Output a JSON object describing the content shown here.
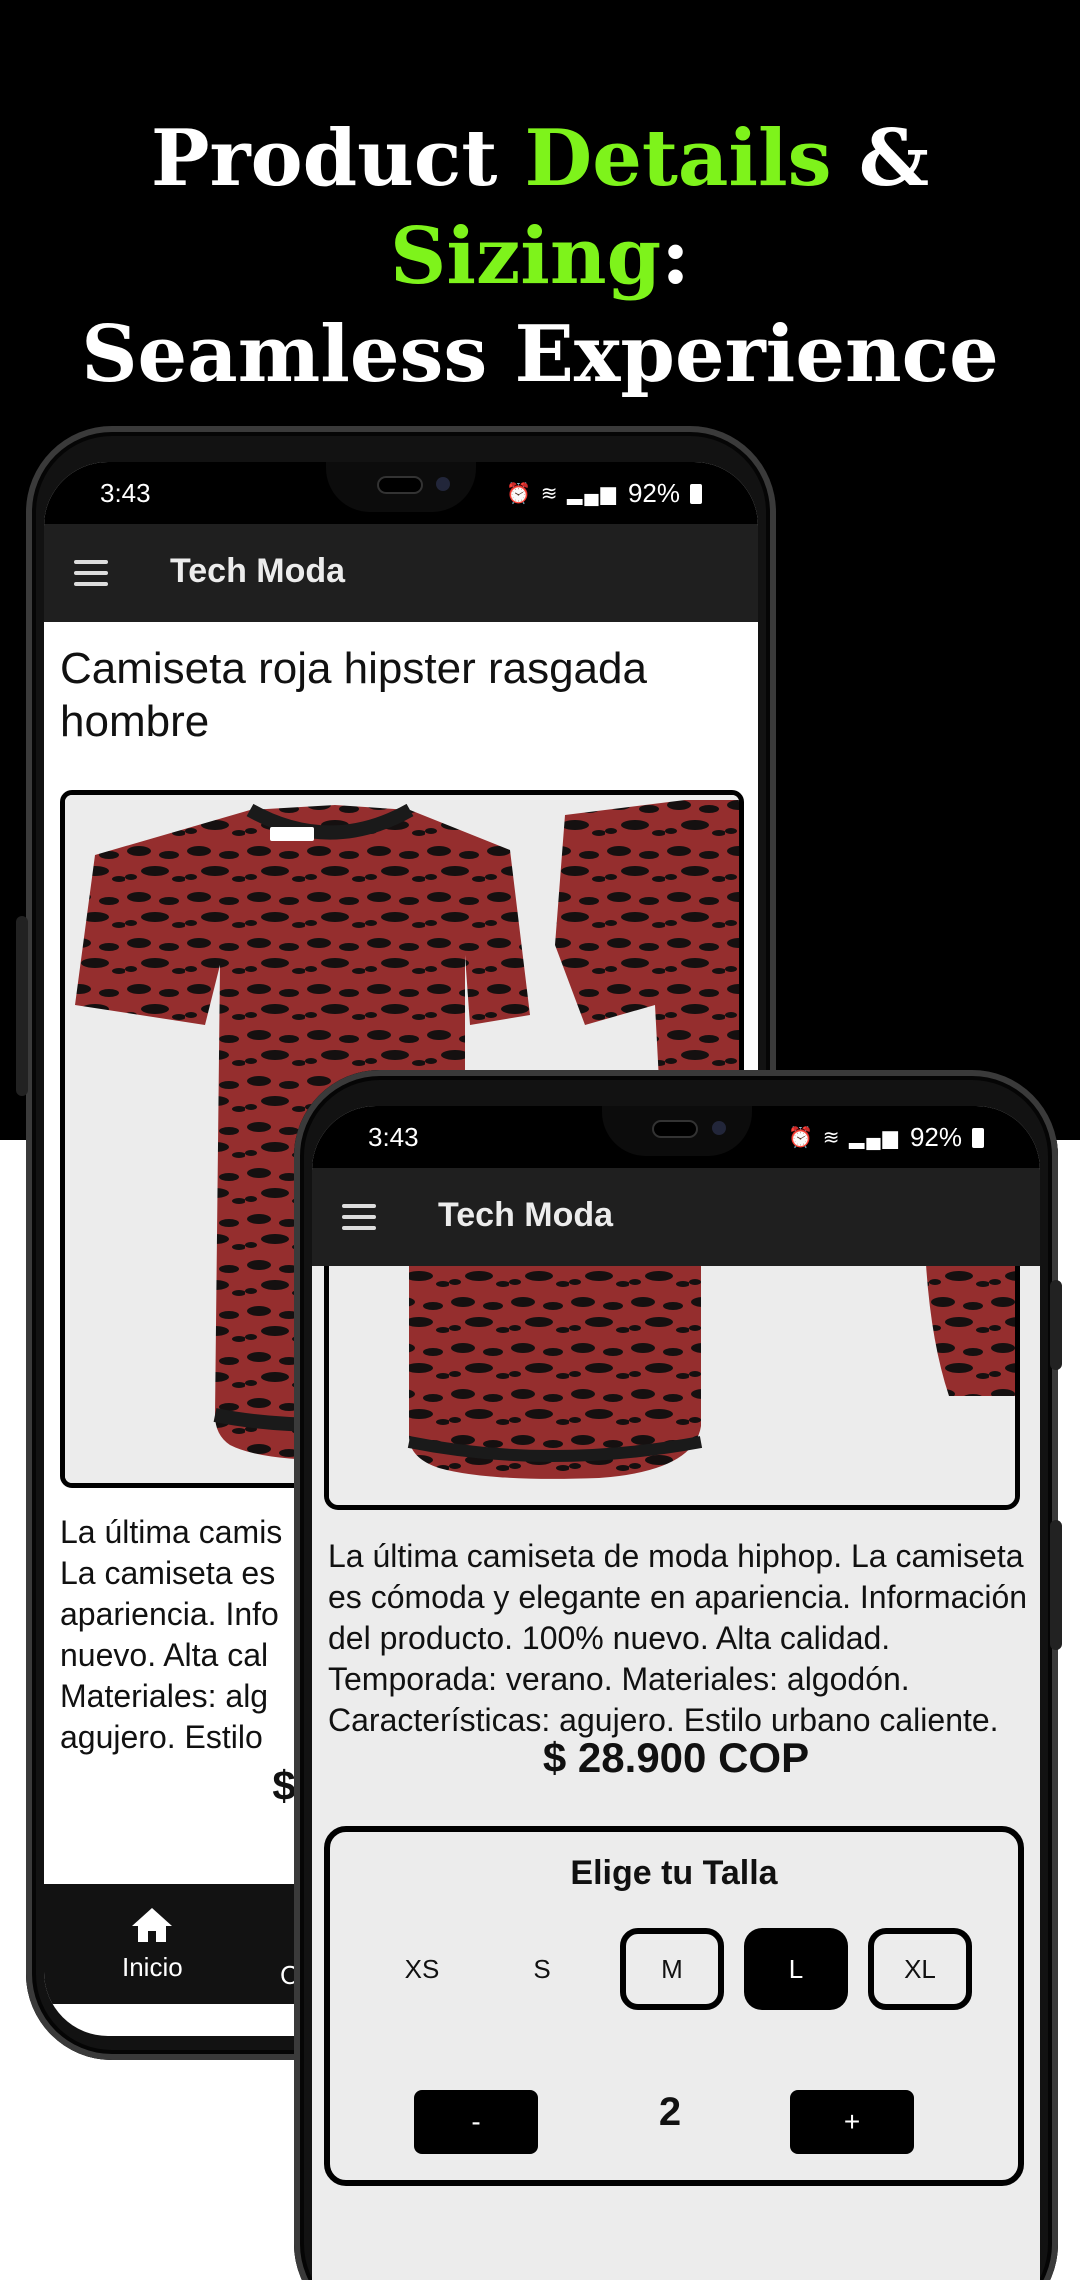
{
  "headline": {
    "line1": {
      "w1": "Product",
      "w2": "Details",
      "w3": "&",
      "w4": "Sizing",
      "w5": ":"
    },
    "line2": "Seamless Experience",
    "accent_color": "#7ef31b"
  },
  "status_bar": {
    "time": "3:43",
    "battery": "92%",
    "icons": [
      "alarm-icon",
      "wifi-calling-icon",
      "volte-icon",
      "signal-icon",
      "battery-icon"
    ]
  },
  "app_bar": {
    "title": "Tech Moda",
    "menu_icon": "menu-icon"
  },
  "product": {
    "title": "Camiseta roja hipster rasgada hombre",
    "description": "La última camiseta de moda hiphop. La camiseta es cómoda y elegante en apariencia. Información del producto. 100% nuevo. Alta calidad. Temporada: verano. Materiales: algodón. Características: agujero. Estilo urbano caliente.",
    "description_cropped": "La última camis La camiseta es apariencia. Info nuevo. Alta cal Materiales: alg agujero. Estilo",
    "price": "$ 28.900 COP",
    "price_cropped": "$"
  },
  "bottom_nav": {
    "items": [
      {
        "label": "Inicio",
        "icon": "home-icon"
      },
      {
        "label": "C"
      }
    ]
  },
  "size_selector": {
    "title": "Elige tu Talla",
    "sizes": [
      {
        "label": "XS",
        "state": "plain"
      },
      {
        "label": "S",
        "state": "plain"
      },
      {
        "label": "M",
        "state": "outlined"
      },
      {
        "label": "L",
        "state": "selected"
      },
      {
        "label": "XL",
        "state": "outlined"
      }
    ],
    "minus_label": "-",
    "plus_label": "+",
    "quantity": "2"
  },
  "colors": {
    "shirt_red": "#8f2a2a",
    "app_bar": "#1f1f1f",
    "background_top": "#000000"
  }
}
